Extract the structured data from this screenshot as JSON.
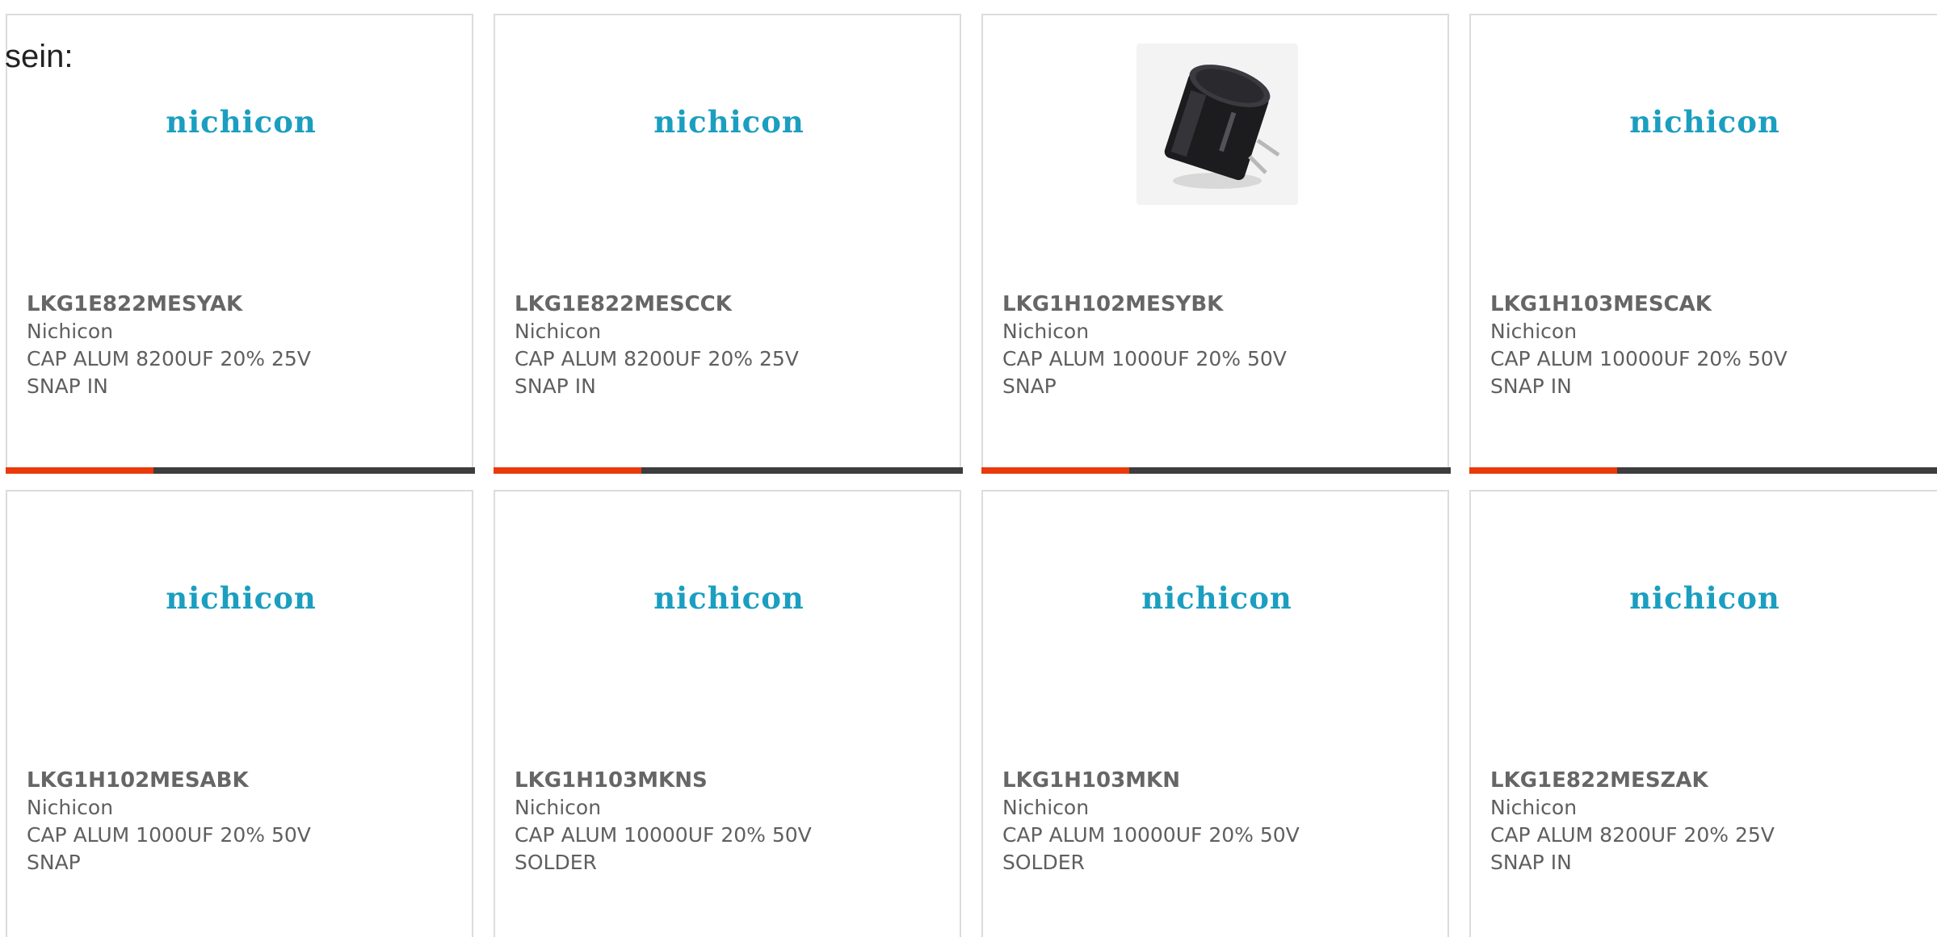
{
  "intro_text": "sein:",
  "colors": {
    "logo": "#1b9ec0",
    "accent_bar": "#ea3a0c",
    "bar": "#3d3d3d",
    "text": "#5f5f5f"
  },
  "cards": [
    {
      "part_number": "LKG1E822MESYAK",
      "manufacturer": "Nichicon",
      "description_line1": "CAP ALUM 8200UF 20% 25V",
      "description_line2": "SNAP IN",
      "image": "nichicon-logo",
      "logo_text": "nichicon"
    },
    {
      "part_number": "LKG1E822MESCCK",
      "manufacturer": "Nichicon",
      "description_line1": "CAP ALUM 8200UF 20% 25V",
      "description_line2": "SNAP IN",
      "image": "nichicon-logo",
      "logo_text": "nichicon"
    },
    {
      "part_number": "LKG1H102MESYBK",
      "manufacturer": "Nichicon",
      "description_line1": "CAP ALUM 1000UF 20% 50V",
      "description_line2": "SNAP",
      "image": "capacitor-photo"
    },
    {
      "part_number": "LKG1H103MESCAK",
      "manufacturer": "Nichicon",
      "description_line1": "CAP ALUM 10000UF 20% 50V",
      "description_line2": "SNAP IN",
      "image": "nichicon-logo",
      "logo_text": "nichicon"
    },
    {
      "part_number": "LKG1H102MESABK",
      "manufacturer": "Nichicon",
      "description_line1": "CAP ALUM 1000UF 20% 50V",
      "description_line2": "SNAP",
      "image": "nichicon-logo",
      "logo_text": "nichicon"
    },
    {
      "part_number": "LKG1H103MKNS",
      "manufacturer": "Nichicon",
      "description_line1": "CAP ALUM 10000UF 20% 50V",
      "description_line2": "SOLDER",
      "image": "nichicon-logo",
      "logo_text": "nichicon"
    },
    {
      "part_number": "LKG1H103MKN",
      "manufacturer": "Nichicon",
      "description_line1": "CAP ALUM 10000UF 20% 50V",
      "description_line2": "SOLDER",
      "image": "nichicon-logo",
      "logo_text": "nichicon"
    },
    {
      "part_number": "LKG1E822MESZAK",
      "manufacturer": "Nichicon",
      "description_line1": "CAP ALUM 8200UF 20% 25V",
      "description_line2": "SNAP IN",
      "image": "nichicon-logo",
      "logo_text": "nichicon"
    }
  ]
}
